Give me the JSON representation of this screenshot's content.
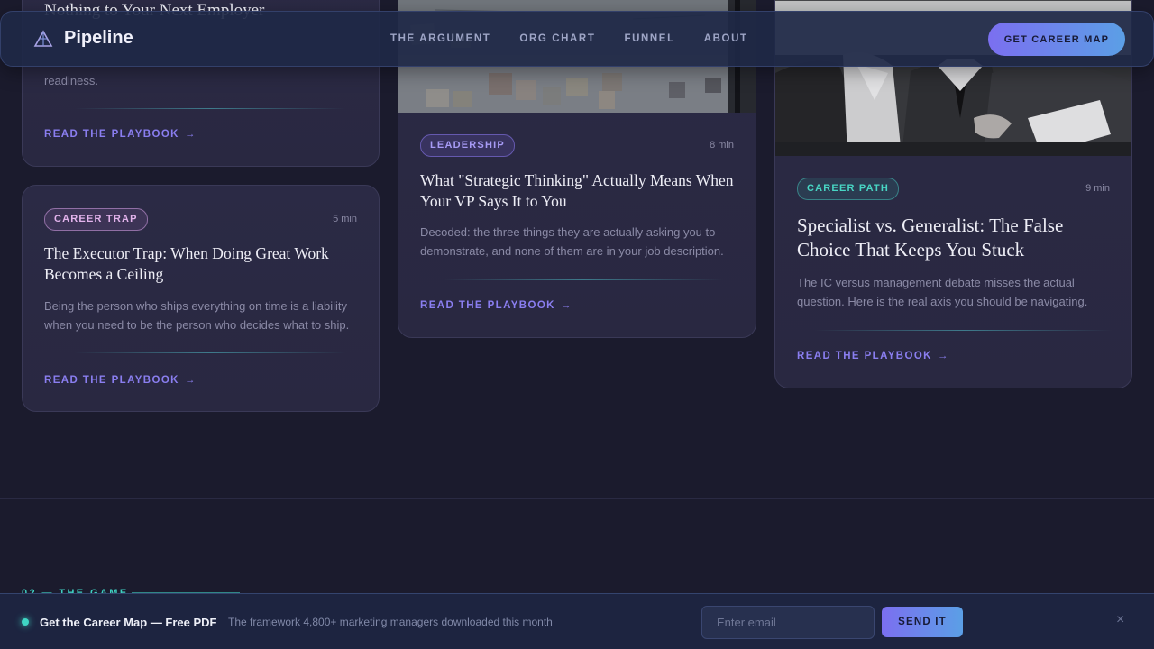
{
  "nav": {
    "brand": "Pipeline",
    "logo_icon": "pyramid-logo-icon",
    "links": [
      "THE ARGUMENT",
      "ORG CHART",
      "FUNNEL",
      "ABOUT"
    ],
    "cta": "GET CAREER MAP"
  },
  "cards": {
    "top_left": {
      "title_fragment": "Nothing to Your Next Employer",
      "desc_tail": "readiness.",
      "read_label": "READ THE PLAYBOOK"
    },
    "executor_trap": {
      "tag": "CAREER TRAP",
      "minutes": "5 min",
      "title": "The Executor Trap: When Doing Great Work Becomes a Ceiling",
      "desc": "Being the person who ships everything on time is a liability when you need to be the person who decides what to ship.",
      "read_label": "READ THE PLAYBOOK"
    },
    "strategic_thinking": {
      "tag": "LEADERSHIP",
      "minutes": "8 min",
      "title": "What \"Strategic Thinking\" Actually Means When Your VP Says It to You",
      "desc": "Decoded: the three things they are actually asking you to demonstrate, and none of them are in your job description.",
      "read_label": "READ THE PLAYBOOK"
    },
    "specialist": {
      "tag": "CAREER PATH",
      "minutes": "9 min",
      "title": "Specialist vs. Generalist: The False Choice That Keeps You Stuck",
      "desc": "The IC versus management debate misses the actual question. Here is the real axis you should be navigating.",
      "read_label": "READ THE PLAYBOOK"
    }
  },
  "section": {
    "label": "02 — THE GAME"
  },
  "bottom_bar": {
    "title": "Get the Career Map — Free PDF",
    "subtitle": "The framework 4,800+ marketing managers downloaded this month",
    "email_placeholder": "Enter email",
    "send_label": "SEND IT",
    "close": "×"
  },
  "colors": {
    "background": "#1b1b2d",
    "accent_violet": "#8a7ef0",
    "accent_teal": "#3fd6c4",
    "card": "#2b2a45"
  }
}
